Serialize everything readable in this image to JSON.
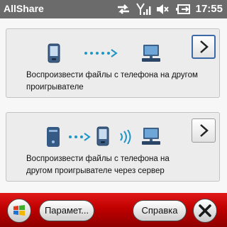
{
  "status_bar": {
    "app_title": "AllShare",
    "time": "17:55",
    "icons": [
      "sync-arrows-icon",
      "signal-strength-icon",
      "speaker-muted-icon",
      "battery-charging-icon"
    ]
  },
  "options": [
    {
      "label": "Воспроизвести файлы с телефона на другом проигрывателе",
      "line1": "Воспроизвести файлы с телефона на другом",
      "line2": "проигрывателе",
      "diagram_icons": [
        "phone-icon",
        "dotted-arrow-icon",
        "computer-icon"
      ],
      "selected": true
    },
    {
      "label": "Воспроизвести файлы с телефона на другом проигрывателе через сервер",
      "line1": "Воспроизвести файлы с телефона на",
      "line2": "другом проигрывателе через сервер",
      "diagram_icons": [
        "server-icon",
        "dotted-arrow-icon",
        "phone-icon",
        "wireless-icon",
        "computer-icon"
      ],
      "selected": false
    }
  ],
  "bottom_bar": {
    "start_icon": "windows-start-icon",
    "settings_label": "Парамет...",
    "help_label": "Справка",
    "close_icon": "close-icon"
  },
  "colors": {
    "status_bar": "#6b6b6b",
    "bottom_bar": "#c00000",
    "accent_arrow": "#1e96c8",
    "selected_border": "#3c6aa8"
  }
}
